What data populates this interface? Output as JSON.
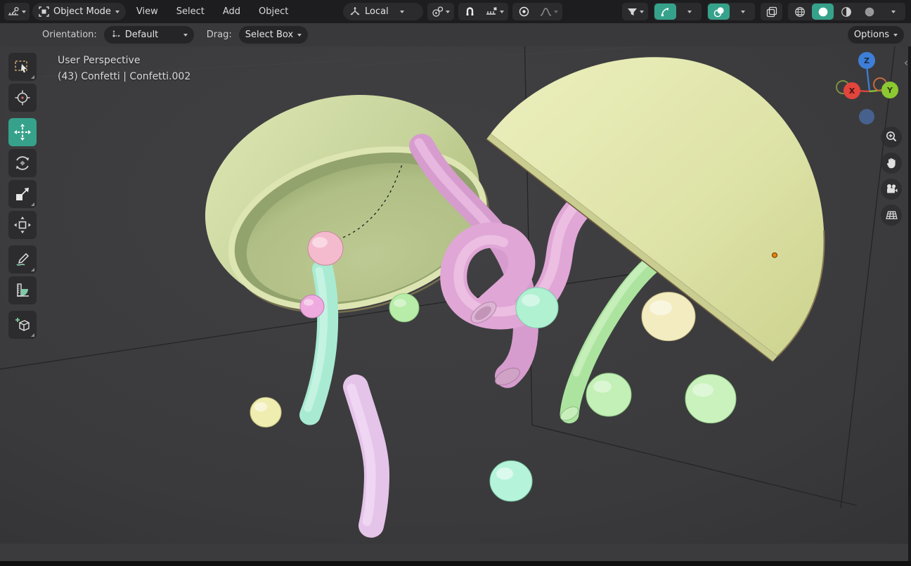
{
  "topbar": {
    "mode_label": "Object Mode",
    "menus": {
      "view": "View",
      "select": "Select",
      "add": "Add",
      "object": "Object"
    },
    "orientation": "Local"
  },
  "tool_settings": {
    "orientation_label": "Orientation:",
    "orientation_value": "Default",
    "drag_label": "Drag:",
    "drag_value": "Select Box",
    "options_label": "Options"
  },
  "viewport": {
    "view_label": "User Perspective",
    "active_object_label": "(43) Confetti | Confetti.002",
    "gizmo": {
      "x": "X",
      "y": "Y",
      "z": "Z"
    }
  },
  "left_toolbar": {
    "active_tool": "move",
    "tools": [
      "select-box",
      "cursor",
      "move",
      "rotate",
      "scale",
      "transform",
      "annotate",
      "measure",
      "add-cube"
    ]
  },
  "scene": {
    "objects": [
      "dome-left",
      "dome-right",
      "pink-curl-tube",
      "pink-back-tube",
      "lavender-tube",
      "mint-tube",
      "green-tube",
      "confetti-spheres"
    ],
    "colors": {
      "accent": "#36a28b",
      "viewport_bg": "#3b3b3d",
      "grid_line": "#232324",
      "dome_left": "#c6d39b",
      "dome_left_inner": "#b4c28c",
      "dome_right": "#dfe3ab",
      "tube_pink": "#e0a6d6",
      "tube_pink_dark": "#d69ccd",
      "tube_lavender": "#e5c4e9",
      "tube_mint": "#a8ebd2",
      "tube_green": "#ace49f",
      "ball_pink": "#f4bacd",
      "ball_small_pink": "#efabdf",
      "ball_green": "#b7eda8",
      "ball_mint": "#b0f1d2",
      "ball_cream": "#f3ecc1",
      "ball_yellow": "#f0edb1",
      "ball_green2": "#c3f0b6",
      "ball_green3": "#c9f2bd",
      "ball_cyan": "#b5f4da",
      "origin_dot": "#e8820d",
      "gizmo_x": "#e2453c",
      "gizmo_y": "#8bc832",
      "gizmo_z": "#3d7fd8"
    }
  }
}
